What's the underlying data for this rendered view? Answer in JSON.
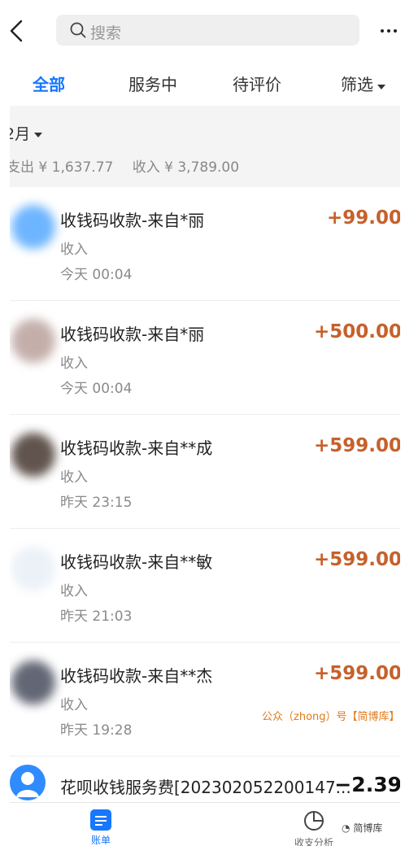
{
  "search": {
    "placeholder": "搜索"
  },
  "tabs": [
    {
      "label": "全部",
      "active": true
    },
    {
      "label": "服务中",
      "active": false
    },
    {
      "label": "待评价",
      "active": false
    },
    {
      "label": "筛选",
      "active": false
    }
  ],
  "month": {
    "label": "2月",
    "expense": "支出 ¥ 1,637.77",
    "income": "收入 ¥ 3,789.00"
  },
  "transactions": [
    {
      "title": "收钱码收款-来自*丽",
      "amount": "+99.00",
      "category": "收入",
      "time": "今天 00:04",
      "avatar_color": "#4aa3ff"
    },
    {
      "title": "收钱码收款-来自*丽",
      "amount": "+500.00",
      "category": "收入",
      "time": "今天 00:04",
      "avatar_color": "#b69b96"
    },
    {
      "title": "收钱码收款-来自**成",
      "amount": "+599.00",
      "category": "收入",
      "time": "昨天 23:15",
      "avatar_color": "#3a2a22"
    },
    {
      "title": "收钱码收款-来自**敏",
      "amount": "+599.00",
      "category": "收入",
      "time": "昨天 21:03",
      "avatar_color": "#e6eef6"
    },
    {
      "title": "收钱码收款-来自**杰",
      "amount": "+599.00",
      "category": "收入",
      "time": "昨天 19:28",
      "avatar_color": "#3c4253"
    }
  ],
  "last_transaction": {
    "title": "花呗收钱服务费[202302052200147...",
    "amount": "−2.39"
  },
  "watermark": "公众（zhong）号【简博库】",
  "bottom_nav": {
    "bill": "账单",
    "analysis": "收支分析"
  },
  "credit": "简博库"
}
